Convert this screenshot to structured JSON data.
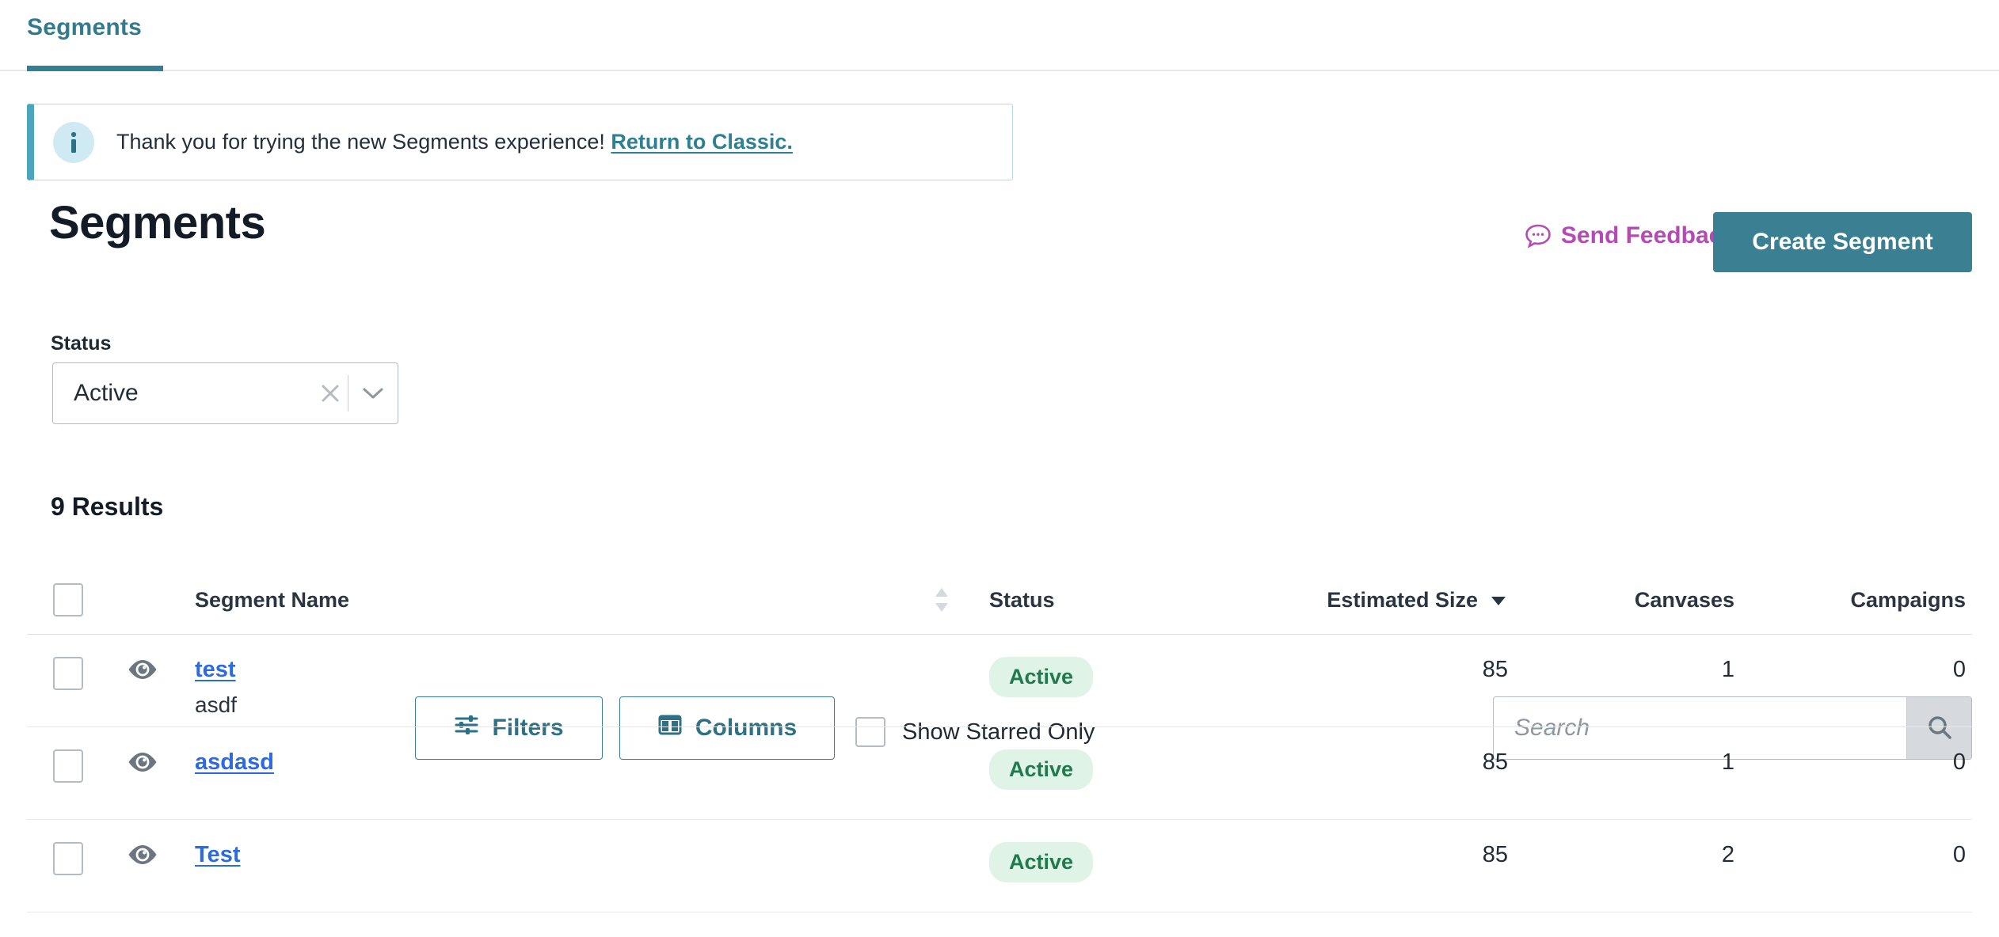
{
  "tabs": [
    {
      "label": "Segments",
      "active": true
    }
  ],
  "banner": {
    "icon": "info-icon",
    "message": "Thank you for trying the new Segments experience!",
    "link_label": "Return to Classic."
  },
  "header": {
    "title": "Segments",
    "feedback_label": "Send Feedback",
    "feedback_icon": "chat-bubble-icon",
    "feedback_color": "#b44bb4",
    "create_label": "Create Segment",
    "create_color": "#3a7f92"
  },
  "controls": {
    "status_label": "Status",
    "status_value": "Active",
    "clear_icon": "close-icon",
    "caret_icon": "chevron-down-icon",
    "filters_label": "Filters",
    "filters_icon": "sliders-icon",
    "columns_label": "Columns",
    "columns_icon": "columns-icon",
    "starred_label": "Show Starred Only",
    "starred_checked": false,
    "search_value": "",
    "search_placeholder": "Search",
    "search_icon": "search-icon"
  },
  "results": {
    "count_label": "9 Results"
  },
  "table": {
    "columns": {
      "select_all": "",
      "name": "Segment Name",
      "name_sort_icon": "sort-both-icon",
      "status": "Status",
      "size": "Estimated Size",
      "size_sort_icon": "sort-desc-icon",
      "canvases": "Canvases",
      "campaigns": "Campaigns"
    },
    "rows": [
      {
        "checked": false,
        "eye_icon": "eye-icon",
        "name": "test",
        "description": "asdf",
        "status": "Active",
        "estimated_size": "85",
        "canvases": "1",
        "campaigns": "0"
      },
      {
        "checked": false,
        "eye_icon": "eye-icon",
        "name": "asdasd",
        "description": "",
        "status": "Active",
        "estimated_size": "85",
        "canvases": "1",
        "campaigns": "0"
      },
      {
        "checked": false,
        "eye_icon": "eye-icon",
        "name": "Test",
        "description": "",
        "status": "Active",
        "estimated_size": "85",
        "canvases": "2",
        "campaigns": "0"
      }
    ]
  }
}
